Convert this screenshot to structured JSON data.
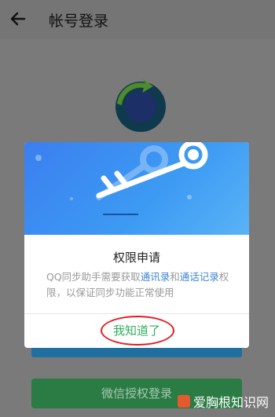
{
  "header": {
    "title": "帐号登录"
  },
  "background": {
    "wechat_login_label": "微信授权登录"
  },
  "dialog": {
    "title": "权限申请",
    "message_part1": "QQ同步助手需要获取",
    "link_contacts": "通讯录",
    "message_and": "和",
    "link_call_log": "通话记录",
    "message_part2": "权限，以保证同步功能正常使用",
    "ok_label": "我知道了"
  },
  "watermark": {
    "text": "爱胸根知识网"
  },
  "colors": {
    "accent_blue": "#3d86d4",
    "ok_green": "#2fae5d",
    "highlight_red": "#e21b22"
  }
}
